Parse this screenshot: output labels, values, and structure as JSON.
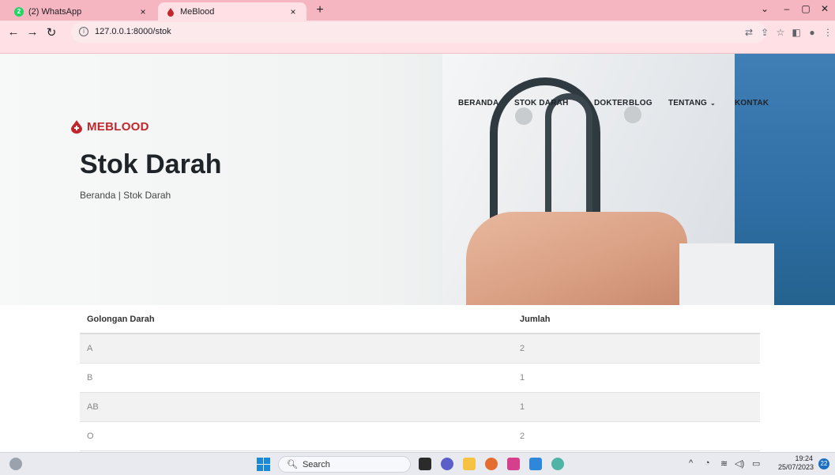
{
  "browser": {
    "tabs": [
      {
        "title": "(2) WhatsApp",
        "badge": "2",
        "active": false
      },
      {
        "title": "MeBlood",
        "active": true
      }
    ],
    "close_glyph": "×",
    "new_tab_glyph": "+",
    "url": "127.0.0.1:8000/stok",
    "window_controls": {
      "dropdown": "⌄",
      "minimize": "–",
      "restore": "▢",
      "close": "✕"
    }
  },
  "site": {
    "logo_text": "MEBLOOD",
    "nav": [
      {
        "label": "BERANDA"
      },
      {
        "label": "STOK DARAH"
      },
      {
        "label": "DOKTER"
      },
      {
        "label": "BLOG"
      },
      {
        "label": "TENTANG"
      },
      {
        "label": "KONTAK"
      }
    ],
    "page_title": "Stok Darah",
    "breadcrumb": "Beranda | Stok Darah"
  },
  "table": {
    "headers": [
      "Golongan Darah",
      "Jumlah"
    ],
    "rows": [
      [
        "A",
        "2"
      ],
      [
        "B",
        "1"
      ],
      [
        "AB",
        "1"
      ],
      [
        "O",
        "2"
      ]
    ]
  },
  "taskbar": {
    "search_label": "Search",
    "time": "19:24",
    "date": "25/07/2023",
    "notification_count": "22"
  },
  "colors": {
    "brand_red": "#c0272d",
    "tabbar_pink": "#f6b6c1",
    "toolbar_pink": "#ffe0e5"
  }
}
